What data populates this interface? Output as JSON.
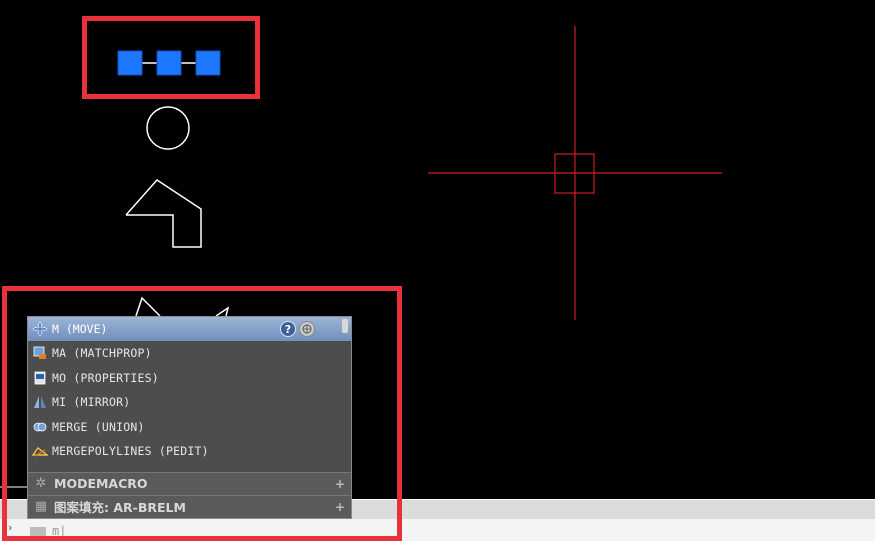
{
  "autocomplete": {
    "highlighted": {
      "label": "M (MOVE)",
      "icon": "move-icon"
    },
    "items": [
      {
        "label": "MA (MATCHPROP)",
        "icon": "matchprop-icon"
      },
      {
        "label": "MO (PROPERTIES)",
        "icon": "properties-icon"
      },
      {
        "label": "MI (MIRROR)",
        "icon": "mirror-icon"
      },
      {
        "label": "MERGE (UNION)",
        "icon": "union-icon"
      },
      {
        "label": "MERGEPOLYLINES (PEDIT)",
        "icon": "pedit-icon"
      }
    ],
    "help_label": "?",
    "sections": [
      {
        "label": "MODEMACRO",
        "icon": "gear-icon",
        "expand": "+"
      },
      {
        "label": "图案填充: AR-BRELM",
        "icon": "hatch-icon",
        "expand": "+"
      }
    ]
  },
  "command_line": {
    "typed": "m|"
  },
  "colors": {
    "highlight_box": "#e8313a",
    "crosshair": "#cc1f1f",
    "grip_blue": "#1e78ff",
    "background": "#000000"
  }
}
